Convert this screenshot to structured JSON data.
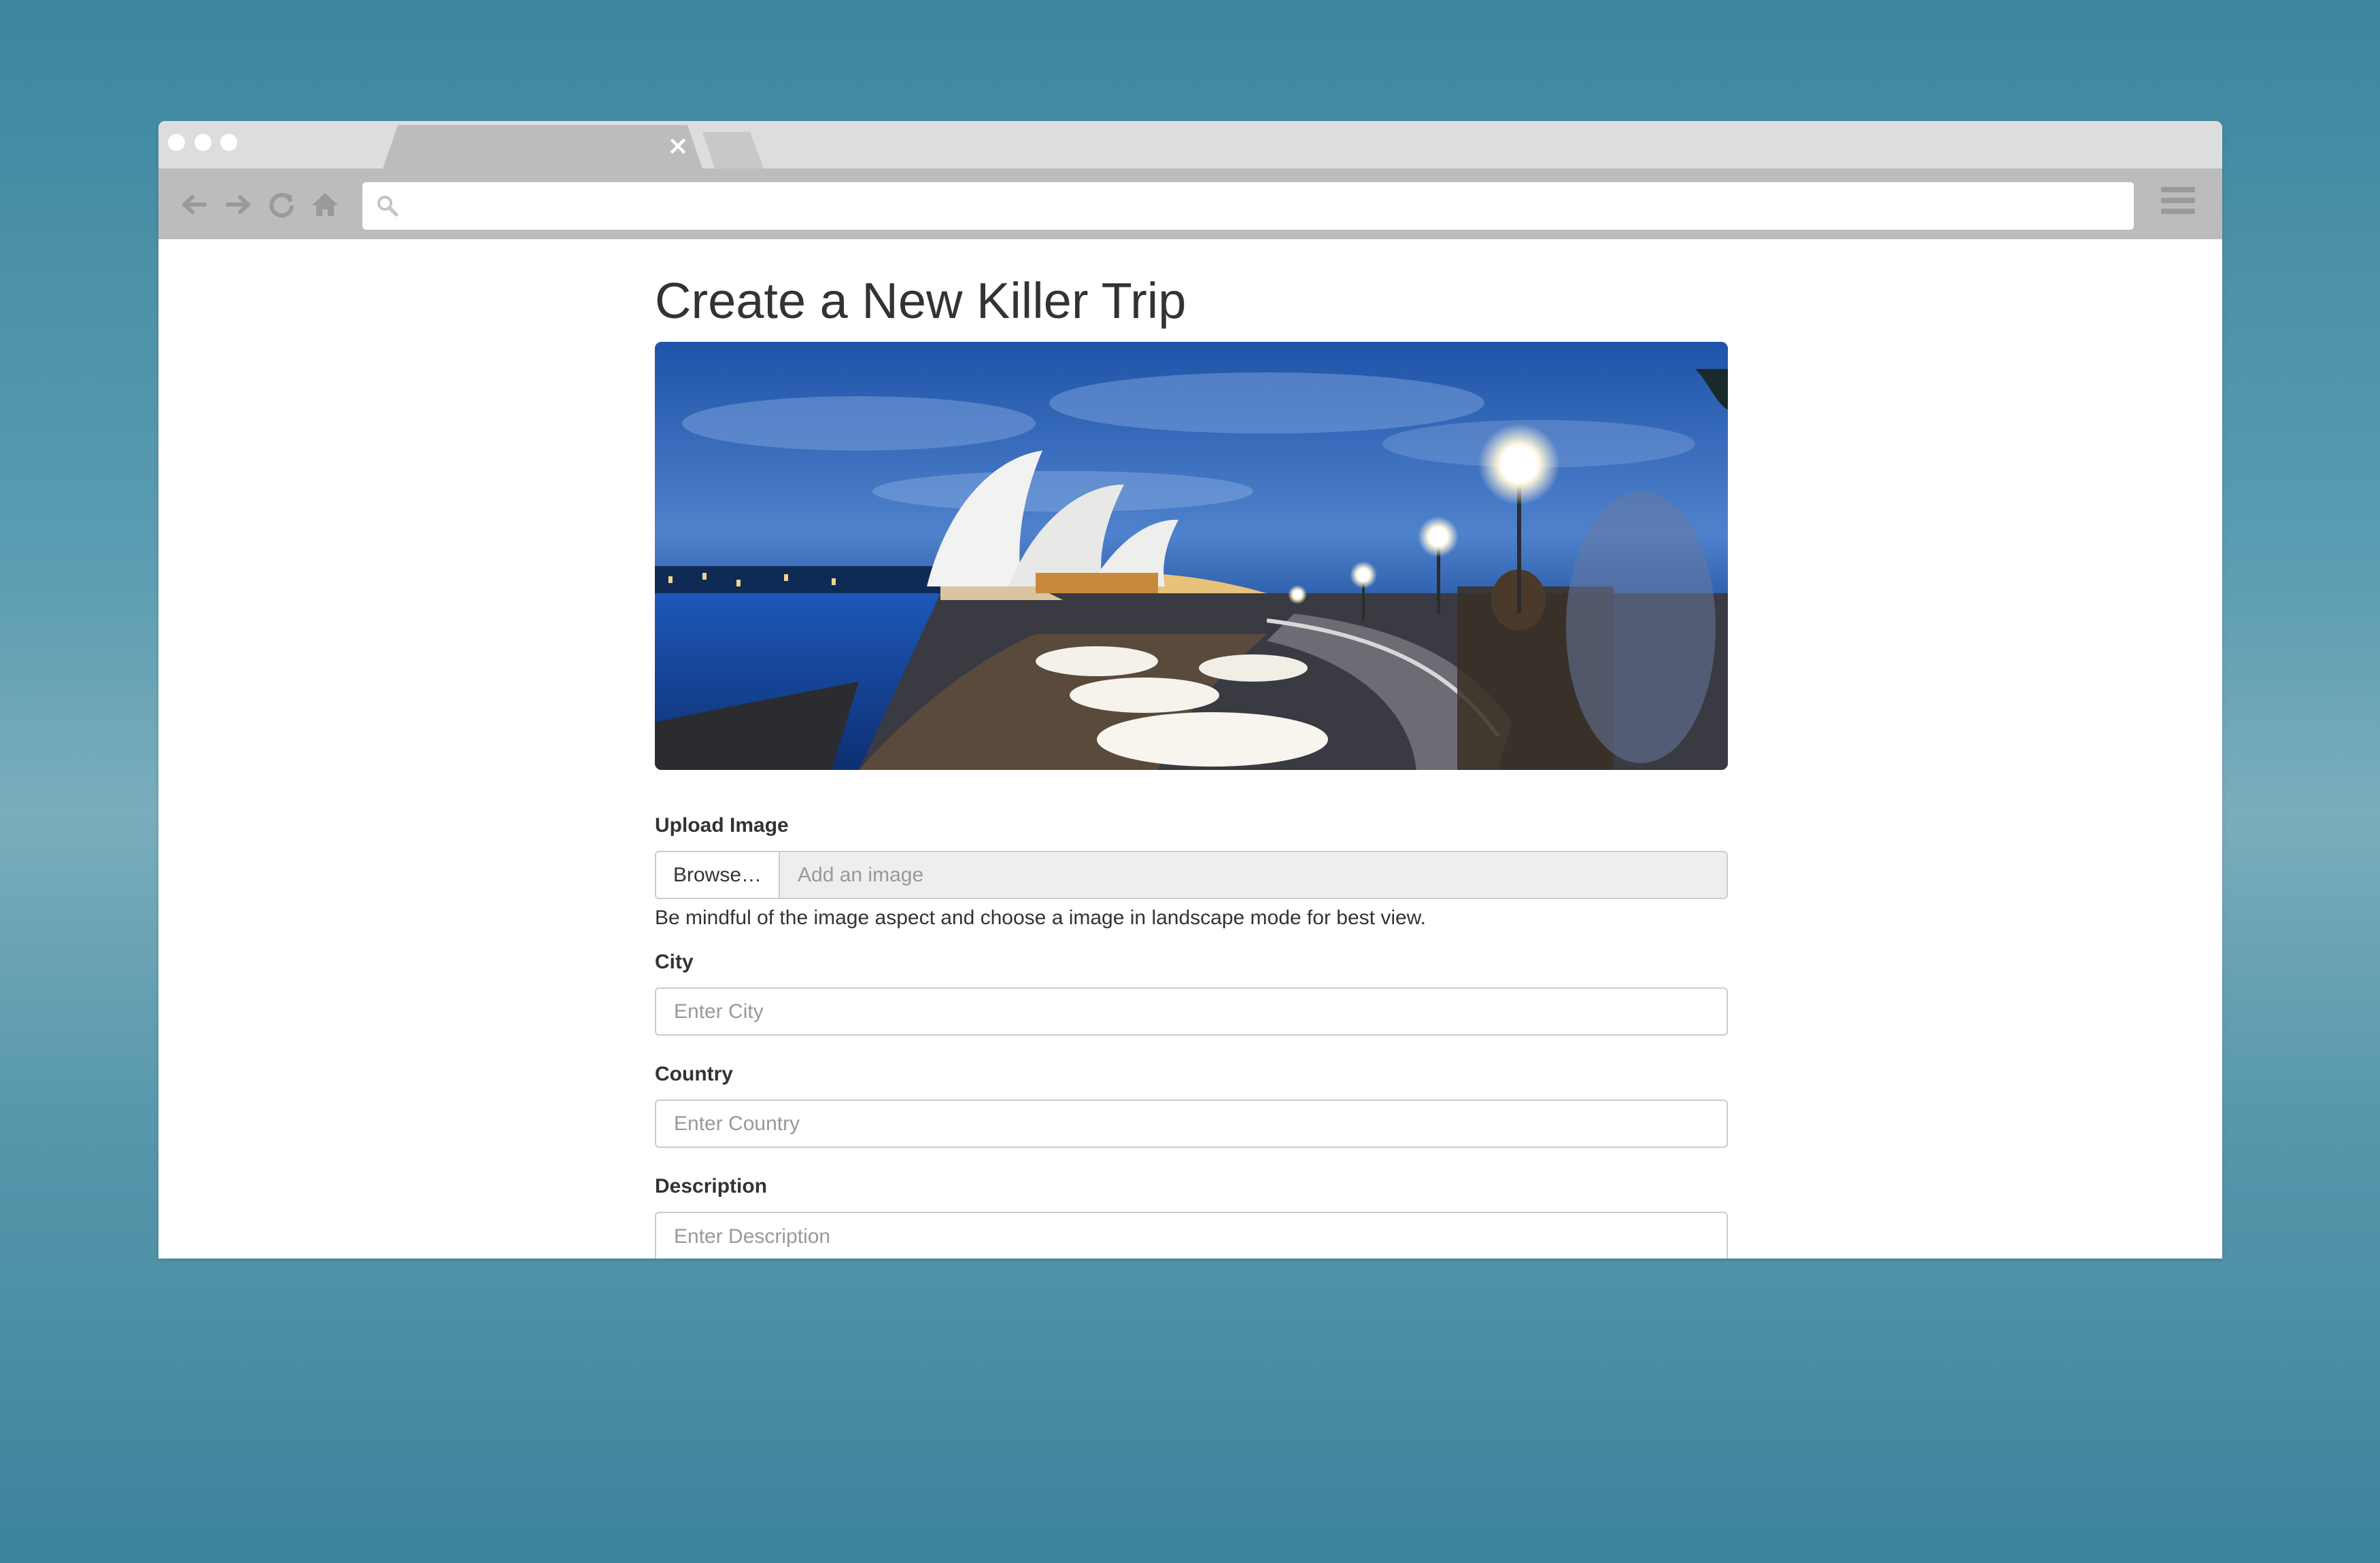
{
  "browser": {
    "tab_close_glyph": "×",
    "address_value": ""
  },
  "page": {
    "title": "Create a New Killer Trip"
  },
  "form": {
    "upload": {
      "label": "Upload Image",
      "button_label": "Browse…",
      "placeholder": "Add an image",
      "help": "Be mindful of the image aspect and choose a image in landscape mode for best view."
    },
    "city": {
      "label": "City",
      "placeholder": "Enter City"
    },
    "country": {
      "label": "Country",
      "placeholder": "Enter Country"
    },
    "description": {
      "label": "Description",
      "placeholder": "Enter Description"
    }
  },
  "icons": {
    "back": "arrow-left-icon",
    "forward": "arrow-right-icon",
    "reload": "reload-icon",
    "home": "home-icon",
    "search": "search-icon",
    "menu": "hamburger-menu-icon",
    "close": "close-icon"
  },
  "colors": {
    "background": "#3c869e",
    "tabbar": "#dddddd",
    "toolbar": "#bcbcbc",
    "text": "#333333",
    "input_border": "#cccccc"
  }
}
